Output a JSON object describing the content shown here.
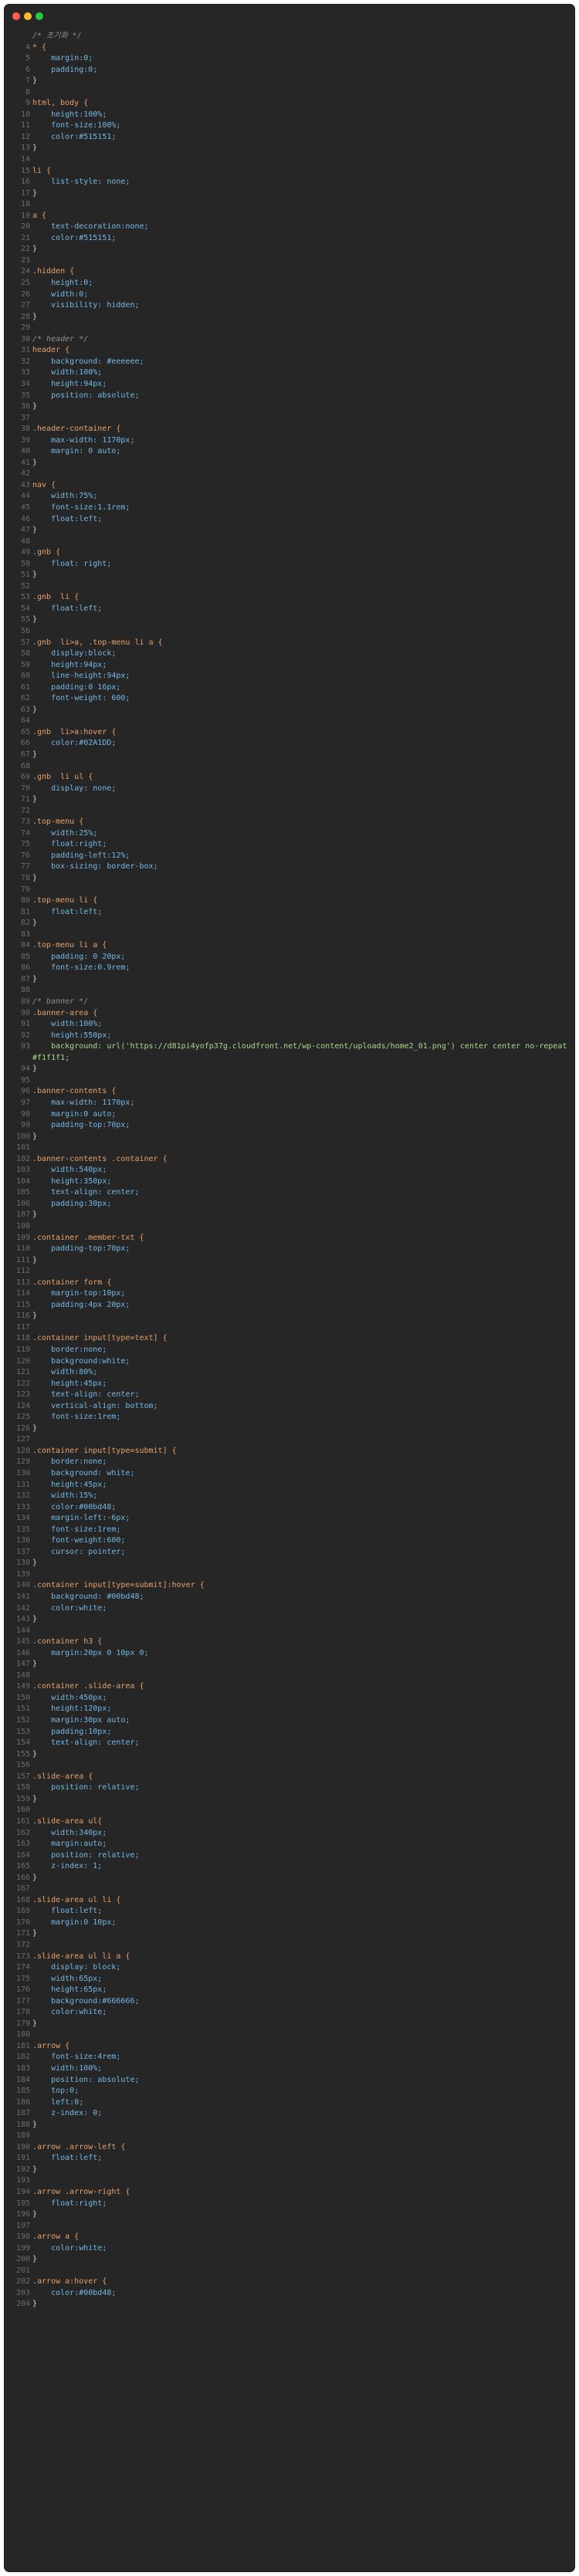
{
  "window": {
    "controls": [
      "close",
      "minimize",
      "zoom"
    ]
  },
  "lines": [
    {
      "n": "",
      "t": "/* 초기화 */",
      "k": "comment"
    },
    {
      "n": "4",
      "t": "* {",
      "k": "sel"
    },
    {
      "n": "5",
      "t": "    margin:0;",
      "k": "prop"
    },
    {
      "n": "6",
      "t": "    padding:0;",
      "k": "prop"
    },
    {
      "n": "7",
      "t": "}",
      "k": "brace"
    },
    {
      "n": "8",
      "t": "",
      "k": "blank"
    },
    {
      "n": "9",
      "t": "html, body {",
      "k": "sel"
    },
    {
      "n": "10",
      "t": "    height:100%;",
      "k": "prop"
    },
    {
      "n": "11",
      "t": "    font-size:100%;",
      "k": "prop"
    },
    {
      "n": "12",
      "t": "    color:#515151;",
      "k": "prop"
    },
    {
      "n": "13",
      "t": "}",
      "k": "brace"
    },
    {
      "n": "14",
      "t": "",
      "k": "blank"
    },
    {
      "n": "15",
      "t": "li {",
      "k": "sel"
    },
    {
      "n": "16",
      "t": "    list-style: none;",
      "k": "prop"
    },
    {
      "n": "17",
      "t": "}",
      "k": "brace"
    },
    {
      "n": "18",
      "t": "",
      "k": "blank"
    },
    {
      "n": "19",
      "t": "a {",
      "k": "sel"
    },
    {
      "n": "20",
      "t": "    text-decoration:none;",
      "k": "prop"
    },
    {
      "n": "21",
      "t": "    color:#515151;",
      "k": "prop"
    },
    {
      "n": "22",
      "t": "}",
      "k": "brace"
    },
    {
      "n": "23",
      "t": "",
      "k": "blank"
    },
    {
      "n": "24",
      "t": ".hidden {",
      "k": "sel"
    },
    {
      "n": "25",
      "t": "    height:0;",
      "k": "prop"
    },
    {
      "n": "26",
      "t": "    width:0;",
      "k": "prop"
    },
    {
      "n": "27",
      "t": "    visibility: hidden;",
      "k": "prop"
    },
    {
      "n": "28",
      "t": "}",
      "k": "brace"
    },
    {
      "n": "29",
      "t": "",
      "k": "blank"
    },
    {
      "n": "30",
      "t": "/* header */",
      "k": "comment"
    },
    {
      "n": "31",
      "t": "header {",
      "k": "sel"
    },
    {
      "n": "32",
      "t": "    background: #eeeeee;",
      "k": "prop"
    },
    {
      "n": "33",
      "t": "    width:100%;",
      "k": "prop"
    },
    {
      "n": "34",
      "t": "    height:94px;",
      "k": "prop"
    },
    {
      "n": "35",
      "t": "    position: absolute;",
      "k": "prop"
    },
    {
      "n": "36",
      "t": "}",
      "k": "brace"
    },
    {
      "n": "37",
      "t": "",
      "k": "blank"
    },
    {
      "n": "38",
      "t": ".header-container {",
      "k": "sel"
    },
    {
      "n": "39",
      "t": "    max-width: 1170px;",
      "k": "prop"
    },
    {
      "n": "40",
      "t": "    margin: 0 auto;",
      "k": "prop"
    },
    {
      "n": "41",
      "t": "}",
      "k": "brace"
    },
    {
      "n": "42",
      "t": "",
      "k": "blank"
    },
    {
      "n": "43",
      "t": "nav {",
      "k": "sel"
    },
    {
      "n": "44",
      "t": "    width:75%;",
      "k": "prop"
    },
    {
      "n": "45",
      "t": "    font-size:1.1rem;",
      "k": "prop"
    },
    {
      "n": "46",
      "t": "    float:left;",
      "k": "prop"
    },
    {
      "n": "47",
      "t": "}",
      "k": "brace"
    },
    {
      "n": "48",
      "t": "",
      "k": "blank"
    },
    {
      "n": "49",
      "t": ".gnb {",
      "k": "sel"
    },
    {
      "n": "50",
      "t": "    float: right;",
      "k": "prop"
    },
    {
      "n": "51",
      "t": "}",
      "k": "brace"
    },
    {
      "n": "52",
      "t": "",
      "k": "blank"
    },
    {
      "n": "53",
      "t": ".gnb  li {",
      "k": "sel"
    },
    {
      "n": "54",
      "t": "    float:left;",
      "k": "prop"
    },
    {
      "n": "55",
      "t": "}",
      "k": "brace"
    },
    {
      "n": "56",
      "t": "",
      "k": "blank"
    },
    {
      "n": "57",
      "t": ".gnb  li>a, .top-menu li a {",
      "k": "sel"
    },
    {
      "n": "58",
      "t": "    display:block;",
      "k": "prop"
    },
    {
      "n": "59",
      "t": "    height:94px;",
      "k": "prop"
    },
    {
      "n": "60",
      "t": "    line-height:94px;",
      "k": "prop"
    },
    {
      "n": "61",
      "t": "    padding:0 16px;",
      "k": "prop"
    },
    {
      "n": "62",
      "t": "    font-weight: 600;",
      "k": "prop"
    },
    {
      "n": "63",
      "t": "}",
      "k": "brace"
    },
    {
      "n": "64",
      "t": "",
      "k": "blank"
    },
    {
      "n": "65",
      "t": ".gnb  li>a:hover {",
      "k": "sel"
    },
    {
      "n": "66",
      "t": "    color:#02A1DD;",
      "k": "prop"
    },
    {
      "n": "67",
      "t": "}",
      "k": "brace"
    },
    {
      "n": "68",
      "t": "",
      "k": "blank"
    },
    {
      "n": "69",
      "t": ".gnb  li ul {",
      "k": "sel"
    },
    {
      "n": "70",
      "t": "    display: none;",
      "k": "prop"
    },
    {
      "n": "71",
      "t": "}",
      "k": "brace"
    },
    {
      "n": "72",
      "t": "",
      "k": "blank"
    },
    {
      "n": "73",
      "t": ".top-menu {",
      "k": "sel"
    },
    {
      "n": "74",
      "t": "    width:25%;",
      "k": "prop"
    },
    {
      "n": "75",
      "t": "    float:right;",
      "k": "prop"
    },
    {
      "n": "76",
      "t": "    padding-left:12%;",
      "k": "prop"
    },
    {
      "n": "77",
      "t": "    box-sizing: border-box;",
      "k": "prop"
    },
    {
      "n": "78",
      "t": "}",
      "k": "brace"
    },
    {
      "n": "79",
      "t": "",
      "k": "blank"
    },
    {
      "n": "80",
      "t": ".top-menu li {",
      "k": "sel"
    },
    {
      "n": "81",
      "t": "    float:left;",
      "k": "prop"
    },
    {
      "n": "82",
      "t": "}",
      "k": "brace"
    },
    {
      "n": "83",
      "t": "",
      "k": "blank"
    },
    {
      "n": "84",
      "t": ".top-menu li a {",
      "k": "sel"
    },
    {
      "n": "85",
      "t": "    padding: 0 20px;",
      "k": "prop"
    },
    {
      "n": "86",
      "t": "    font-size:0.9rem;",
      "k": "prop"
    },
    {
      "n": "87",
      "t": "}",
      "k": "brace"
    },
    {
      "n": "88",
      "t": "",
      "k": "blank"
    },
    {
      "n": "89",
      "t": "/* banner */",
      "k": "comment"
    },
    {
      "n": "90",
      "t": ".banner-area {",
      "k": "sel"
    },
    {
      "n": "91",
      "t": "    width:100%;",
      "k": "prop"
    },
    {
      "n": "92",
      "t": "    height:550px;",
      "k": "prop"
    },
    {
      "n": "93",
      "t": "    background: url('https://d81pi4yofp37g.cloudfront.net/wp-content/uploads/home2_01.png') center center no-repeat #f1f1f1;",
      "k": "wrap"
    },
    {
      "n": "94",
      "t": "}",
      "k": "brace"
    },
    {
      "n": "95",
      "t": "",
      "k": "blank"
    },
    {
      "n": "96",
      "t": ".banner-contents {",
      "k": "sel"
    },
    {
      "n": "97",
      "t": "    max-width: 1170px;",
      "k": "prop"
    },
    {
      "n": "98",
      "t": "    margin:0 auto;",
      "k": "prop"
    },
    {
      "n": "99",
      "t": "    padding-top:70px;",
      "k": "prop"
    },
    {
      "n": "100",
      "t": "}",
      "k": "brace"
    },
    {
      "n": "101",
      "t": "",
      "k": "blank"
    },
    {
      "n": "102",
      "t": ".banner-contents .container {",
      "k": "sel"
    },
    {
      "n": "103",
      "t": "    width:540px;",
      "k": "prop"
    },
    {
      "n": "104",
      "t": "    height:350px;",
      "k": "prop"
    },
    {
      "n": "105",
      "t": "    text-align: center;",
      "k": "prop"
    },
    {
      "n": "106",
      "t": "    padding:30px;",
      "k": "prop"
    },
    {
      "n": "107",
      "t": "}",
      "k": "brace"
    },
    {
      "n": "108",
      "t": "",
      "k": "blank"
    },
    {
      "n": "109",
      "t": ".container .member-txt {",
      "k": "sel"
    },
    {
      "n": "110",
      "t": "    padding-top:70px;",
      "k": "prop"
    },
    {
      "n": "111",
      "t": "}",
      "k": "brace"
    },
    {
      "n": "112",
      "t": "",
      "k": "blank"
    },
    {
      "n": "113",
      "t": ".container form {",
      "k": "sel"
    },
    {
      "n": "114",
      "t": "    margin-top:10px;",
      "k": "prop"
    },
    {
      "n": "115",
      "t": "    padding:4px 20px;",
      "k": "prop"
    },
    {
      "n": "116",
      "t": "}",
      "k": "brace"
    },
    {
      "n": "117",
      "t": "",
      "k": "blank"
    },
    {
      "n": "118",
      "t": ".container input[type=text] {",
      "k": "sel"
    },
    {
      "n": "119",
      "t": "    border:none;",
      "k": "prop"
    },
    {
      "n": "120",
      "t": "    background:white;",
      "k": "prop"
    },
    {
      "n": "121",
      "t": "    width:80%;",
      "k": "prop"
    },
    {
      "n": "122",
      "t": "    height:45px;",
      "k": "prop"
    },
    {
      "n": "123",
      "t": "    text-align: center;",
      "k": "prop"
    },
    {
      "n": "124",
      "t": "    vertical-align: bottom;",
      "k": "prop"
    },
    {
      "n": "125",
      "t": "    font-size:1rem;",
      "k": "prop"
    },
    {
      "n": "126",
      "t": "}",
      "k": "brace"
    },
    {
      "n": "127",
      "t": "",
      "k": "blank"
    },
    {
      "n": "128",
      "t": ".container input[type=submit] {",
      "k": "sel"
    },
    {
      "n": "129",
      "t": "    border:none;",
      "k": "prop"
    },
    {
      "n": "130",
      "t": "    background: white;",
      "k": "prop"
    },
    {
      "n": "131",
      "t": "    height:45px;",
      "k": "prop"
    },
    {
      "n": "132",
      "t": "    width:15%;",
      "k": "prop"
    },
    {
      "n": "133",
      "t": "    color:#00bd48;",
      "k": "prop"
    },
    {
      "n": "134",
      "t": "    margin-left:-6px;",
      "k": "prop"
    },
    {
      "n": "135",
      "t": "    font-size:1rem;",
      "k": "prop"
    },
    {
      "n": "136",
      "t": "    font-weight:600;",
      "k": "prop"
    },
    {
      "n": "137",
      "t": "    cursor: pointer;",
      "k": "prop"
    },
    {
      "n": "138",
      "t": "}",
      "k": "brace"
    },
    {
      "n": "139",
      "t": "",
      "k": "blank"
    },
    {
      "n": "140",
      "t": ".container input[type=submit]:hover {",
      "k": "sel"
    },
    {
      "n": "141",
      "t": "    background: #00bd48;",
      "k": "prop"
    },
    {
      "n": "142",
      "t": "    color:white;",
      "k": "prop"
    },
    {
      "n": "143",
      "t": "}",
      "k": "brace"
    },
    {
      "n": "144",
      "t": "",
      "k": "blank"
    },
    {
      "n": "145",
      "t": ".container h3 {",
      "k": "sel"
    },
    {
      "n": "146",
      "t": "    margin:20px 0 10px 0;",
      "k": "prop"
    },
    {
      "n": "147",
      "t": "}",
      "k": "brace"
    },
    {
      "n": "148",
      "t": "",
      "k": "blank"
    },
    {
      "n": "149",
      "t": ".container .slide-area {",
      "k": "sel"
    },
    {
      "n": "150",
      "t": "    width:450px;",
      "k": "prop"
    },
    {
      "n": "151",
      "t": "    height:120px;",
      "k": "prop"
    },
    {
      "n": "152",
      "t": "    margin:30px auto;",
      "k": "prop"
    },
    {
      "n": "153",
      "t": "    padding:10px;",
      "k": "prop"
    },
    {
      "n": "154",
      "t": "    text-align: center;",
      "k": "prop"
    },
    {
      "n": "155",
      "t": "}",
      "k": "brace"
    },
    {
      "n": "156",
      "t": "",
      "k": "blank"
    },
    {
      "n": "157",
      "t": ".slide-area {",
      "k": "sel"
    },
    {
      "n": "158",
      "t": "    position: relative;",
      "k": "prop"
    },
    {
      "n": "159",
      "t": "}",
      "k": "brace"
    },
    {
      "n": "160",
      "t": "",
      "k": "blank"
    },
    {
      "n": "161",
      "t": ".slide-area ul{",
      "k": "sel"
    },
    {
      "n": "162",
      "t": "    width:340px;",
      "k": "prop"
    },
    {
      "n": "163",
      "t": "    margin:auto;",
      "k": "prop"
    },
    {
      "n": "164",
      "t": "    position: relative;",
      "k": "prop"
    },
    {
      "n": "165",
      "t": "    z-index: 1;",
      "k": "prop"
    },
    {
      "n": "166",
      "t": "}",
      "k": "brace"
    },
    {
      "n": "167",
      "t": "",
      "k": "blank"
    },
    {
      "n": "168",
      "t": ".slide-area ul li {",
      "k": "sel"
    },
    {
      "n": "169",
      "t": "    float:left;",
      "k": "prop"
    },
    {
      "n": "170",
      "t": "    margin:0 10px;",
      "k": "prop"
    },
    {
      "n": "171",
      "t": "}",
      "k": "brace"
    },
    {
      "n": "172",
      "t": "",
      "k": "blank"
    },
    {
      "n": "173",
      "t": ".slide-area ul li a {",
      "k": "sel"
    },
    {
      "n": "174",
      "t": "    display: block;",
      "k": "prop"
    },
    {
      "n": "175",
      "t": "    width:65px;",
      "k": "prop"
    },
    {
      "n": "176",
      "t": "    height:65px;",
      "k": "prop"
    },
    {
      "n": "177",
      "t": "    background:#666666;",
      "k": "prop"
    },
    {
      "n": "178",
      "t": "    color:white;",
      "k": "prop"
    },
    {
      "n": "179",
      "t": "}",
      "k": "brace"
    },
    {
      "n": "180",
      "t": "",
      "k": "blank"
    },
    {
      "n": "181",
      "t": ".arrow {",
      "k": "sel"
    },
    {
      "n": "182",
      "t": "    font-size:4rem;",
      "k": "prop"
    },
    {
      "n": "183",
      "t": "    width:100%;",
      "k": "prop"
    },
    {
      "n": "184",
      "t": "    position: absolute;",
      "k": "prop"
    },
    {
      "n": "185",
      "t": "    top:0;",
      "k": "prop"
    },
    {
      "n": "186",
      "t": "    left:0;",
      "k": "prop"
    },
    {
      "n": "187",
      "t": "    z-index: 0;",
      "k": "prop"
    },
    {
      "n": "188",
      "t": "}",
      "k": "brace"
    },
    {
      "n": "189",
      "t": "",
      "k": "blank"
    },
    {
      "n": "190",
      "t": ".arrow .arrow-left {",
      "k": "sel"
    },
    {
      "n": "191",
      "t": "    float:left;",
      "k": "prop"
    },
    {
      "n": "192",
      "t": "}",
      "k": "brace"
    },
    {
      "n": "193",
      "t": "",
      "k": "blank"
    },
    {
      "n": "194",
      "t": ".arrow .arrow-right {",
      "k": "sel"
    },
    {
      "n": "195",
      "t": "    float:right;",
      "k": "prop"
    },
    {
      "n": "196",
      "t": "}",
      "k": "brace"
    },
    {
      "n": "197",
      "t": "",
      "k": "blank"
    },
    {
      "n": "198",
      "t": ".arrow a {",
      "k": "sel"
    },
    {
      "n": "199",
      "t": "    color:white;",
      "k": "prop"
    },
    {
      "n": "200",
      "t": "}",
      "k": "brace"
    },
    {
      "n": "201",
      "t": "",
      "k": "blank"
    },
    {
      "n": "202",
      "t": ".arrow a:hover {",
      "k": "sel"
    },
    {
      "n": "203",
      "t": "    color:#00bd48;",
      "k": "prop"
    },
    {
      "n": "204",
      "t": "}",
      "k": "brace"
    }
  ]
}
